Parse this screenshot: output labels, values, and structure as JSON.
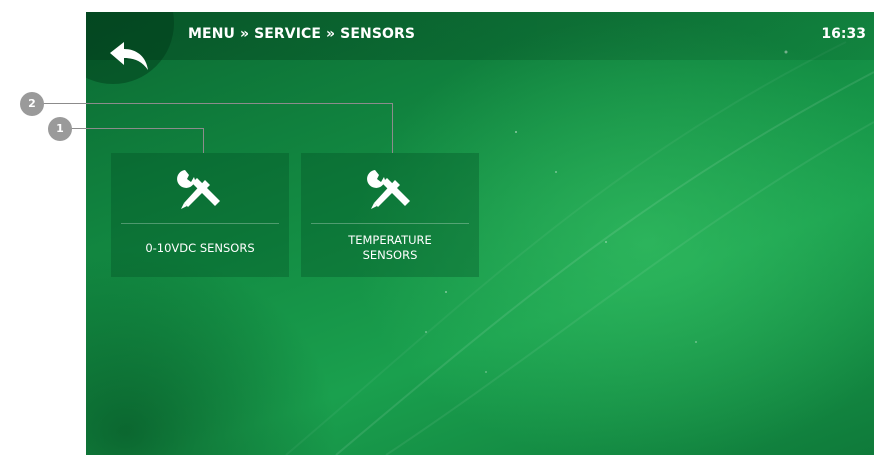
{
  "header": {
    "breadcrumb": "MENU » SERVICE » SENSORS",
    "clock": "16:33",
    "back_icon": "back-arrow-icon"
  },
  "tiles": [
    {
      "label": "0-10VDC SENSORS",
      "icon": "tools-icon"
    },
    {
      "label_line1": "TEMPERATURE",
      "label_line2": "SENSORS",
      "icon": "tools-icon"
    }
  ],
  "callouts": [
    {
      "number": "1"
    },
    {
      "number": "2"
    }
  ],
  "colors": {
    "background_green": "#138c43",
    "tile_overlay": "rgba(0,75,35,0.32)",
    "text": "#ffffff",
    "callout_gray": "#9a9a9a"
  }
}
